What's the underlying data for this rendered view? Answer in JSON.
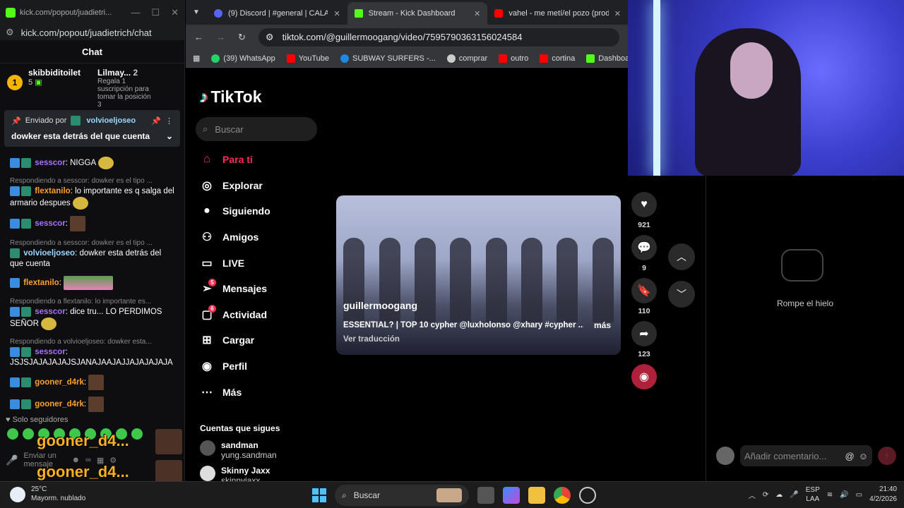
{
  "kick": {
    "window_title": "kick.com/popout/juadietri...",
    "url": "kick.com/popout/juadietrich/chat",
    "chat_title": "Chat",
    "leaderboard": [
      {
        "rank": "1",
        "name": "skibbiditoilet",
        "count": "5"
      },
      {
        "rank": "3",
        "name": "Lilmay...",
        "count": "2",
        "sub": "Regala 1 suscripción para tomar la posición 3"
      }
    ],
    "pinned": {
      "sent_by_label": "Enviado por",
      "user": "volvioeljoseo",
      "message": "dowker esta detrás del que cuenta"
    },
    "messages": [
      {
        "reply": "",
        "user": "sesscor",
        "color": "purple",
        "text": "NIGGA"
      },
      {
        "reply": "Respondiendo a sesscor: dowker es el tipo ...",
        "user": "flextanilo",
        "color": "orange",
        "text": "lo importante es q salga del armario despues"
      },
      {
        "reply": "",
        "user": "sesscor",
        "color": "purple",
        "text": ""
      },
      {
        "reply": "Respondiendo a sesscor: dowker es el tipo ...",
        "user": "volvioeljoseo",
        "color": "cyan",
        "text": "dowker esta detrás del que cuenta"
      },
      {
        "reply": "",
        "user": "flextanilo",
        "color": "orange",
        "text": ""
      },
      {
        "reply": "Respondiendo a flextanilo: lo importante es...",
        "user": "sesscor",
        "color": "purple",
        "text": "dice tru... LO PERDIMOS SEÑOR"
      },
      {
        "reply": "Respondiendo a volvioeljoseo: dowker esta...",
        "user": "sesscor",
        "color": "purple",
        "text": "JSJSJAJAJAJAJSJANAJAAJAJJAJAJAJAJA"
      },
      {
        "reply": "",
        "user": "gooner_d4rk",
        "color": "orange",
        "text": ""
      },
      {
        "reply": "",
        "user": "gooner_d4rk",
        "color": "orange",
        "text": ""
      }
    ],
    "followers_only": "Solo seguidores",
    "input_placeholder": "Enviar un mensaje",
    "overlay_name": "gooner_d4..."
  },
  "browser": {
    "tabs": [
      {
        "label": "(9) Discord | #general | CALAVE...",
        "color": "#5865f2",
        "active": false
      },
      {
        "label": "Stream - Kick Dashboard",
        "color": "#53fc18",
        "active": true
      },
      {
        "label": "vahel - me metí/el pozo (prod",
        "color": "#ff0000",
        "active": false
      }
    ],
    "url": "tiktok.com/@guillermoogang/video/7595790363156024584",
    "bookmarks": [
      {
        "label": "(39) WhatsApp",
        "color": "#25d366"
      },
      {
        "label": "YouTube",
        "color": "#ff0000"
      },
      {
        "label": "SUBWAY SURFERS -...",
        "color": "#1e88e5"
      },
      {
        "label": "comprar",
        "color": "#cccccc"
      },
      {
        "label": "outro",
        "color": "#ff0000"
      },
      {
        "label": "cortina",
        "color": "#ff0000"
      },
      {
        "label": "Dashboard",
        "color": "#53fc18"
      }
    ]
  },
  "tiktok": {
    "logo": "TikTok",
    "search_placeholder": "Buscar",
    "nav": [
      {
        "label": "Para ti",
        "icon": "home-icon",
        "active": true,
        "badge": ""
      },
      {
        "label": "Explorar",
        "icon": "compass-icon",
        "active": false,
        "badge": ""
      },
      {
        "label": "Siguiendo",
        "icon": "avatar-icon",
        "active": false,
        "badge": ""
      },
      {
        "label": "Amigos",
        "icon": "people-icon",
        "active": false,
        "badge": ""
      },
      {
        "label": "LIVE",
        "icon": "tv-icon",
        "active": false,
        "badge": ""
      },
      {
        "label": "Mensajes",
        "icon": "paper-plane-icon",
        "active": false,
        "badge": "5"
      },
      {
        "label": "Actividad",
        "icon": "inbox-icon",
        "active": false,
        "badge": "6"
      },
      {
        "label": "Cargar",
        "icon": "plus-square-icon",
        "active": false,
        "badge": ""
      },
      {
        "label": "Perfil",
        "icon": "profile-icon",
        "active": false,
        "badge": ""
      },
      {
        "label": "Más",
        "icon": "more-icon",
        "active": false,
        "badge": ""
      }
    ],
    "following_title": "Cuentas que sigues",
    "following": [
      {
        "name": "sandman",
        "handle": "yung.sandman"
      },
      {
        "name": "Skinny Jaxx",
        "handle": "skinnyjaxx"
      }
    ],
    "video": {
      "author": "guillermoogang",
      "description": "ESSENTIAL? | TOP 10 cypher @luxholonso @xhary #cypher ...",
      "more": "más",
      "translate": "Ver traducción"
    },
    "actions": [
      {
        "icon": "heart-icon",
        "count": "921"
      },
      {
        "icon": "comment-icon",
        "count": "9"
      },
      {
        "icon": "bookmark-icon",
        "count": "110"
      },
      {
        "icon": "share-icon",
        "count": "123"
      }
    ],
    "comments_empty": "Rompe el hielo",
    "comment_placeholder": "Añadir comentario..."
  },
  "taskbar": {
    "temp": "25°C",
    "weather": "Mayorm. nublado",
    "search": "Buscar",
    "lang_top": "ESP",
    "lang_bottom": "LAA",
    "time": "21:40",
    "date": "4/2/2026"
  }
}
